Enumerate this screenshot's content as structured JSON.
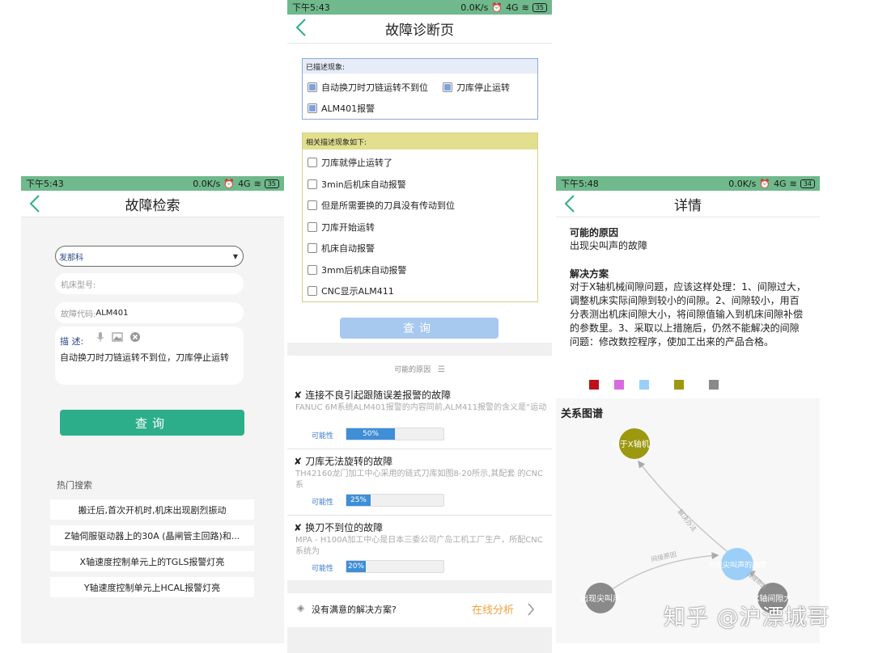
{
  "status": {
    "p1": {
      "time": "下午5:43",
      "net": "0.0K/s",
      "signal": "4G",
      "battery": "35"
    },
    "p2": {
      "time": "下午5:43",
      "net": "0.0K/s",
      "signal": "4G",
      "battery": "35"
    },
    "p3": {
      "time": "下午5:48",
      "net": "0.0K/s",
      "signal": "4G",
      "battery": "34"
    }
  },
  "search_page": {
    "title": "故障检索",
    "brand_select": "发那科",
    "model_placeholder": "机床型号:",
    "code_label": "故障代码:",
    "code_value": "ALM401",
    "desc_label": "描  述:",
    "desc_text": "自动换刀时刀链运转不到位，刀库停止运转",
    "query_button": "查询",
    "hot_title": "热门搜索",
    "hot_items": [
      "搬迁后,首次开机时,机床出现剧烈振动",
      "Z轴伺服驱动器上的30A (晶闸管主回路)和...",
      "X轴速度控制单元上的TGLS报警灯亮",
      "Y轴速度控制单元上HCAL报警灯亮"
    ]
  },
  "diagnosis_page": {
    "title": "故障诊断页",
    "described_header": "已描述现象:",
    "described": [
      "自动换刀时刀链运转不到位",
      "刀库停止运转",
      "ALM401报警"
    ],
    "related_header": "相关描述现象如下:",
    "related": [
      "刀库就停止运转了",
      "3min后机床自动报警",
      "但是所需要换的刀具没有传动到位",
      "刀库开始运转",
      "机床自动报警",
      "3mm后机床自动报警",
      "CNC显示ALM411"
    ],
    "query_button": "查询",
    "causes_title": "可能的原因",
    "causes": [
      {
        "title": "连接不良引起跟随误差报警的故障",
        "desc": "FANUC 6M系统ALM401报警的内容同前,ALM411报警的含义是“运动",
        "prob_label": "可能性",
        "prob": 50,
        "prob_text": "50%"
      },
      {
        "title": "刀库无法旋转的故障",
        "desc": "TH42160龙门加工中心采用的链式刀库如图8-20所示,其配套 的CNC 系",
        "prob_label": "可能性",
        "prob": 25,
        "prob_text": "25%"
      },
      {
        "title": "换刀不到位的故障",
        "desc": "MPA - H100A加工中心是日本三委公司广岛工机工厂生产，所配CNC系统为",
        "prob_label": "可能性",
        "prob": 20,
        "prob_text": "20%"
      }
    ],
    "no_solution": "没有满意的解决方案?",
    "online_analysis": "在线分析"
  },
  "detail_page": {
    "title": "详情",
    "cause_heading": "可能的原因",
    "cause_text": "出现尖叫声的故障",
    "solution_heading": "解决方案",
    "solution_text": "对于X轴机械间隙问题，应该这样处理：1、间隙过大，调整机床实际间隙到较小的间隙。2、间隙较小，用百分表测出机床间隙大小，将间隙值输入到机床间隙补偿的参数里。3、采取以上措施后，仍然不能解决的间隙问题：修改数控程序，使加工出来的产品合格。",
    "legend_colors": [
      "#c0101c",
      "#d86ae0",
      "#9ccff8",
      "#9c9810",
      "#8a8a8a"
    ],
    "graph_title": "关系图谱",
    "graph_nodes": [
      "对于X轴机...",
      "出现尖叫声的故障",
      "出现尖叫声",
      "X轴间隙大"
    ],
    "graph_edges": [
      "解决办法",
      "间接原因",
      "直接原因"
    ]
  },
  "watermark": "知乎 @沪漂城哥",
  "colors": {
    "green": "#2dae8a",
    "status": "#6fb98c",
    "blue": "#3e8ed8",
    "orange": "#f2a23c"
  }
}
